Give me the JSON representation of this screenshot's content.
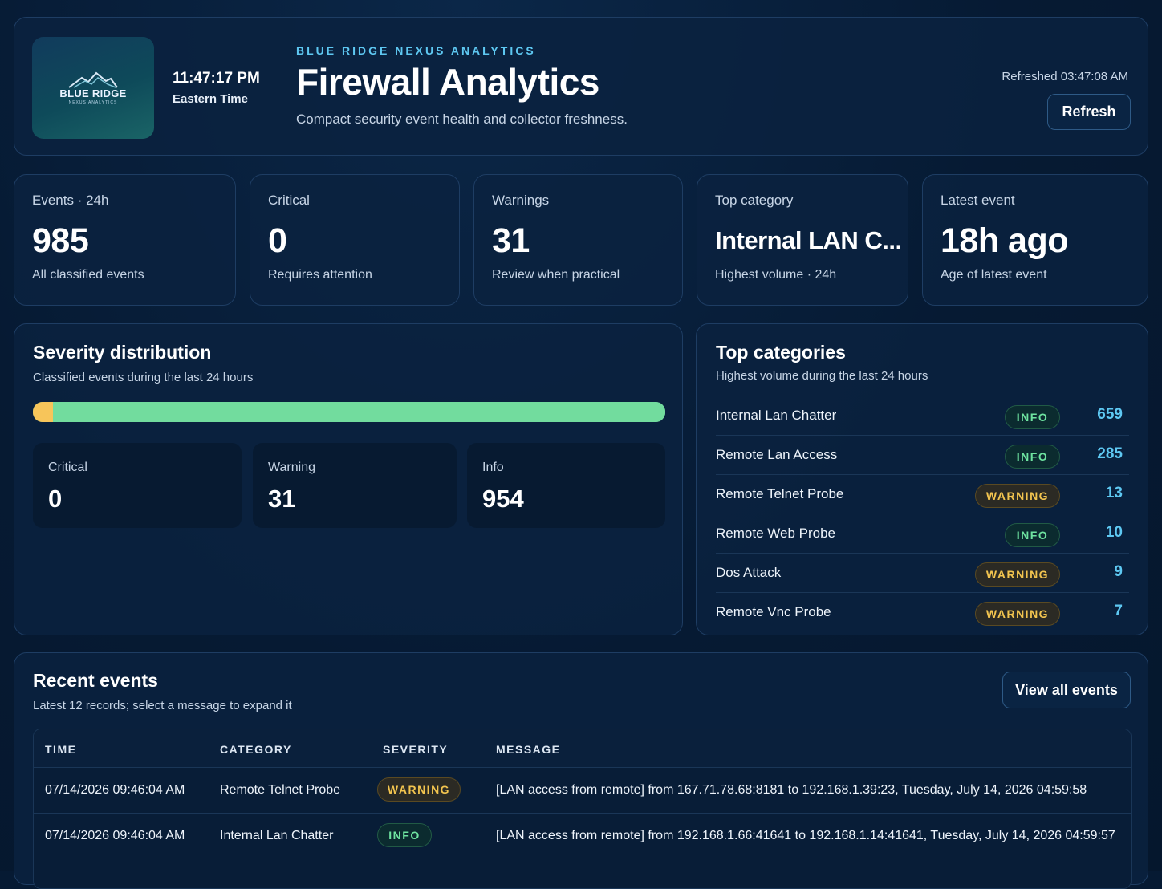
{
  "header": {
    "logo_brand": "BLUE RIDGE",
    "logo_sub": "NEXUS ANALYTICS",
    "clock_time": "11:47:17 PM",
    "clock_tz": "Eastern Time",
    "eyebrow": "BLUE RIDGE NEXUS ANALYTICS",
    "title": "Firewall Analytics",
    "subtitle": "Compact security event health and collector freshness.",
    "refreshed": "Refreshed 03:47:08 AM",
    "refresh_label": "Refresh"
  },
  "stats": [
    {
      "label": "Events · 24h",
      "value": "985",
      "sub": "All classified events"
    },
    {
      "label": "Critical",
      "value": "0",
      "sub": "Requires attention"
    },
    {
      "label": "Warnings",
      "value": "31",
      "sub": "Review when practical"
    },
    {
      "label": "Top category",
      "value": "Internal LAN C...",
      "sub": "Highest volume · 24h"
    },
    {
      "label": "Latest event",
      "value": "18h ago",
      "sub": "Age of latest event"
    }
  ],
  "severity": {
    "title": "Severity distribution",
    "subtitle": "Classified events during the last 24 hours",
    "segments": [
      {
        "name": "Critical",
        "count": 0,
        "color": "#ef5b5b"
      },
      {
        "name": "Warning",
        "count": 31,
        "color": "#f7c55a"
      },
      {
        "name": "Info",
        "count": 954,
        "color": "#72dc9e"
      }
    ],
    "tiles": [
      {
        "label": "Critical",
        "value": "0"
      },
      {
        "label": "Warning",
        "value": "31"
      },
      {
        "label": "Info",
        "value": "954"
      }
    ]
  },
  "top_categories": {
    "title": "Top categories",
    "subtitle": "Highest volume during the last 24 hours",
    "items": [
      {
        "name": "Internal Lan Chatter",
        "severity": "INFO",
        "count": "659"
      },
      {
        "name": "Remote Lan Access",
        "severity": "INFO",
        "count": "285"
      },
      {
        "name": "Remote Telnet Probe",
        "severity": "WARNING",
        "count": "13"
      },
      {
        "name": "Remote Web Probe",
        "severity": "INFO",
        "count": "10"
      },
      {
        "name": "Dos Attack",
        "severity": "WARNING",
        "count": "9"
      },
      {
        "name": "Remote Vnc Probe",
        "severity": "WARNING",
        "count": "7"
      }
    ]
  },
  "recent": {
    "title": "Recent events",
    "subtitle": "Latest 12 records; select a message to expand it",
    "view_all_label": "View all events",
    "columns": [
      "TIME",
      "CATEGORY",
      "SEVERITY",
      "MESSAGE"
    ],
    "rows": [
      {
        "time": "07/14/2026 09:46:04 AM",
        "category": "Remote Telnet Probe",
        "severity": "WARNING",
        "message": "[LAN access from remote] from 167.71.78.68:8181 to 192.168.1.39:23, Tuesday, July 14, 2026 04:59:58"
      },
      {
        "time": "07/14/2026 09:46:04 AM",
        "category": "Internal Lan Chatter",
        "severity": "INFO",
        "message": "[LAN access from remote] from 192.168.1.66:41641 to 192.168.1.14:41641, Tuesday, July 14, 2026 04:59:57"
      }
    ]
  }
}
